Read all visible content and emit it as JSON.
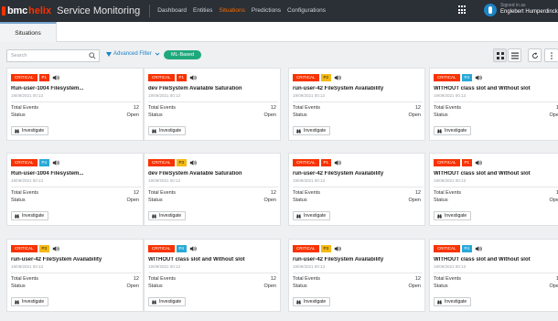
{
  "header": {
    "brand_bmc": "bmc",
    "brand_helix": "helix",
    "app_title": "Service Monitoring",
    "nav": [
      "Dashboard",
      "Entities",
      "Situations",
      "Predictions",
      "Configurations"
    ],
    "active_nav": 2,
    "signed_in_as": "Signed in as",
    "user_name": "Englebert Humperdinck"
  },
  "tabs": {
    "situations": "Situations"
  },
  "toolbar": {
    "search_placeholder": "Search",
    "advanced_filter": "Advanced Filter",
    "ml_badge": "ML-Based"
  },
  "colors": {
    "critical": "#f83200",
    "p1": "#f83200",
    "p2": "#f5b912",
    "p3": "#f5b912",
    "p4": "#29a9d8",
    "accent": "#1d83c6",
    "ml": "#1fa97b"
  },
  "icons": {
    "search": "search-icon",
    "filter": "funnel-icon",
    "tile_view": "grid-view-icon",
    "list_view": "list-view-icon",
    "refresh": "refresh-icon",
    "more": "more-vertical-icon",
    "speaker": "speaker-icon",
    "investigate": "binoculars-icon"
  },
  "labels": {
    "total_events": "Total Events",
    "status": "Status",
    "investigate": "Investigate"
  },
  "cards": [
    {
      "severity": "CRITICAL",
      "priority": "P1",
      "title": "Run-user-1004 Filesystem...",
      "date": "19/09/2021 00:13",
      "total_events": "12",
      "status": "Open"
    },
    {
      "severity": "CRITICAL",
      "priority": "P1",
      "title": "dev FileSystem Available Saturation",
      "date": "19/09/2021 00:13",
      "total_events": "12",
      "status": "Open"
    },
    {
      "severity": "CRITICAL",
      "priority": "P2",
      "title": "run-user-42 FileSystem Availability",
      "date": "19/09/2021 00:13",
      "total_events": "12",
      "status": "Open"
    },
    {
      "severity": "CRITICAL",
      "priority": "P4",
      "title": "WITHOUT class slot and Without slot",
      "date": "19/09/2021 00:13",
      "total_events": "12",
      "status": "Open"
    },
    {
      "severity": "CRITICAL",
      "priority": "P4",
      "title": "Run-user-1004 Filesystem...",
      "date": "19/09/2021 00:13",
      "total_events": "12",
      "status": "Open"
    },
    {
      "severity": "CRITICAL",
      "priority": "P3",
      "title": "dev FileSystem Available Saturation",
      "date": "19/09/2021 00:13",
      "total_events": "12",
      "status": "Open"
    },
    {
      "severity": "CRITICAL",
      "priority": "P1",
      "title": "run-user-42 FileSystem Availability",
      "date": "19/09/2021 00:13",
      "total_events": "12",
      "status": "Open"
    },
    {
      "severity": "CRITICAL",
      "priority": "P1",
      "title": "WITHOUT class slot and Without slot",
      "date": "19/09/2021 00:13",
      "total_events": "12",
      "status": "Open"
    },
    {
      "severity": "CRITICAL",
      "priority": "P3",
      "title": "run-user-42 FileSystem Availability",
      "date": "19/09/2021 00:13",
      "total_events": "12",
      "status": "Open"
    },
    {
      "severity": "CRITICAL",
      "priority": "P4",
      "title": "WITHOUT class slot and Without slot",
      "date": "19/09/2021 00:13",
      "total_events": "12",
      "status": "Open"
    },
    {
      "severity": "CRITICAL",
      "priority": "P3",
      "title": "run-user-42 FileSystem Availability",
      "date": "19/09/2021 00:13",
      "total_events": "12",
      "status": "Open"
    },
    {
      "severity": "CRITICAL",
      "priority": "P4",
      "title": "WITHOUT class slot and Without slot",
      "date": "19/09/2021 00:13",
      "total_events": "12",
      "status": "Open"
    }
  ]
}
